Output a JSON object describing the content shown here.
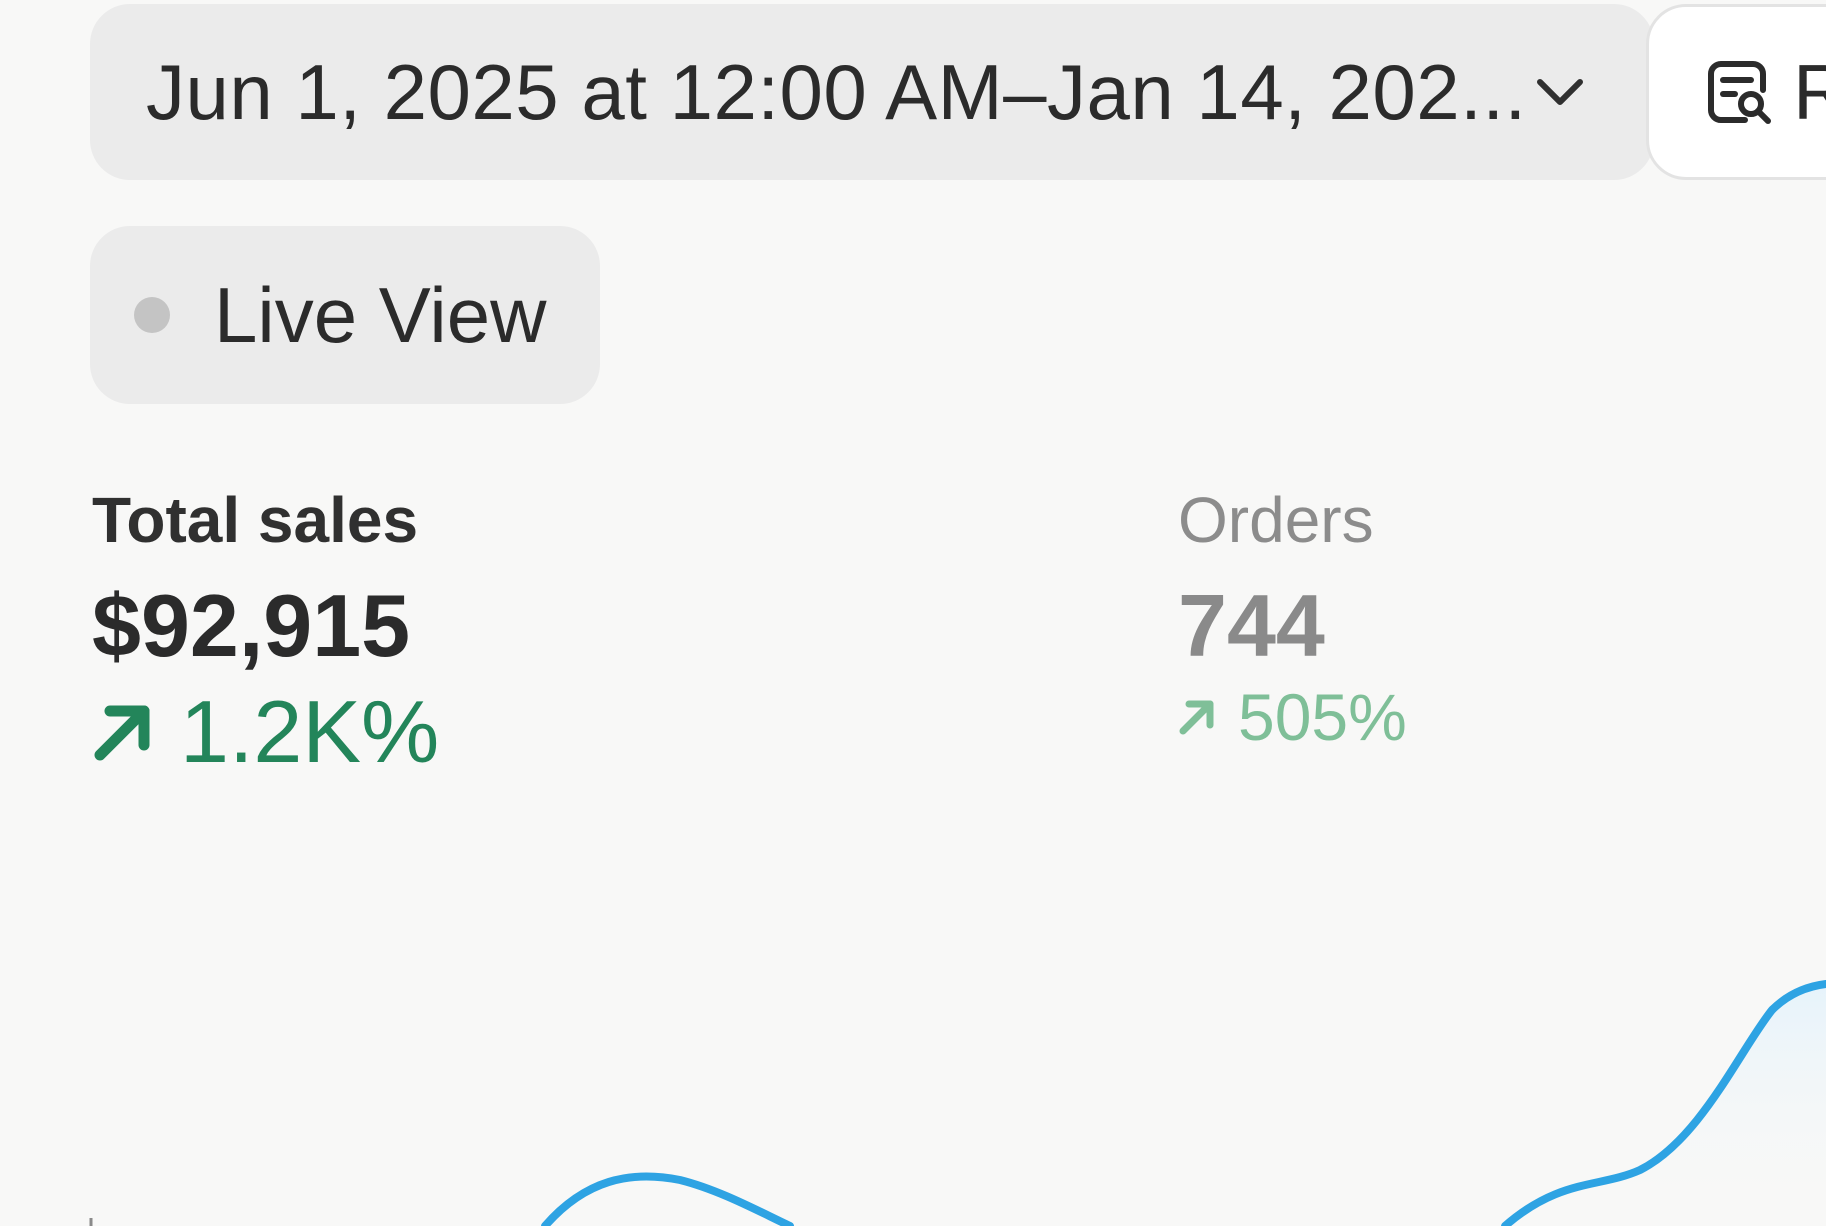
{
  "toolbar": {
    "date_range_label": "Jun 1, 2025 at 12:00 AM–Jan 14, 202...",
    "report_label": "R",
    "live_view_label": "Live View"
  },
  "metrics": {
    "total_sales": {
      "title": "Total sales",
      "value": "$92,915",
      "change": "1.2K%",
      "trend": "up"
    },
    "orders": {
      "title": "Orders",
      "value": "744",
      "change": "505%",
      "trend": "up"
    }
  },
  "icons": {
    "date_dropdown": "chevron-down-icon",
    "report": "report-search-icon",
    "live_status": "status-dot-icon",
    "trend": "arrow-up-right-icon"
  },
  "colors": {
    "positive": "#23855a",
    "positive_muted": "#7fbf98",
    "chart_line": "#2ea3e3",
    "live_dot": "#c4c4c4"
  }
}
